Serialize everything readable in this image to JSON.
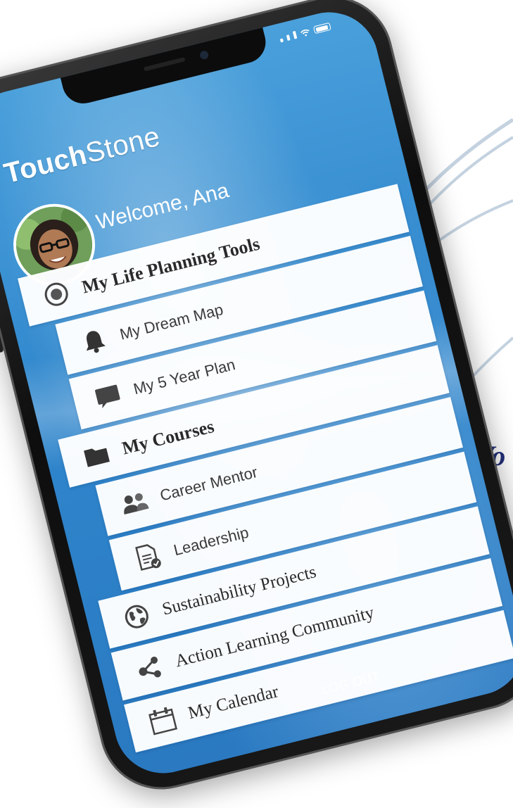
{
  "app": {
    "logo_bold": "Touch",
    "logo_thin": "Stone",
    "welcome": "Welcome, Ana",
    "logout": "LOG OUT"
  },
  "menu": {
    "items": [
      {
        "label": "My Life Planning Tools",
        "icon": "target-icon",
        "kind": "section"
      },
      {
        "label": "My Dream Map",
        "icon": "bell-icon",
        "kind": "sub"
      },
      {
        "label": "My 5 Year Plan",
        "icon": "speech-bubble-icon",
        "kind": "sub"
      },
      {
        "label": "My Courses",
        "icon": "folder-icon",
        "kind": "section"
      },
      {
        "label": "Career Mentor",
        "icon": "people-icon",
        "kind": "sub"
      },
      {
        "label": "Leadership",
        "icon": "document-check-icon",
        "kind": "sub"
      },
      {
        "label": "Sustainability Projects",
        "icon": "globe-icon",
        "kind": "section"
      },
      {
        "label": "Action Learning Community",
        "icon": "share-nodes-icon",
        "kind": "section"
      },
      {
        "label": "My Calendar",
        "icon": "calendar-icon",
        "kind": "section"
      }
    ]
  },
  "decor": {
    "side_text": "Vo",
    "accent_color": "#23307a",
    "screen_color": "#2f86cc",
    "curve_color": "#c4d2e0"
  }
}
